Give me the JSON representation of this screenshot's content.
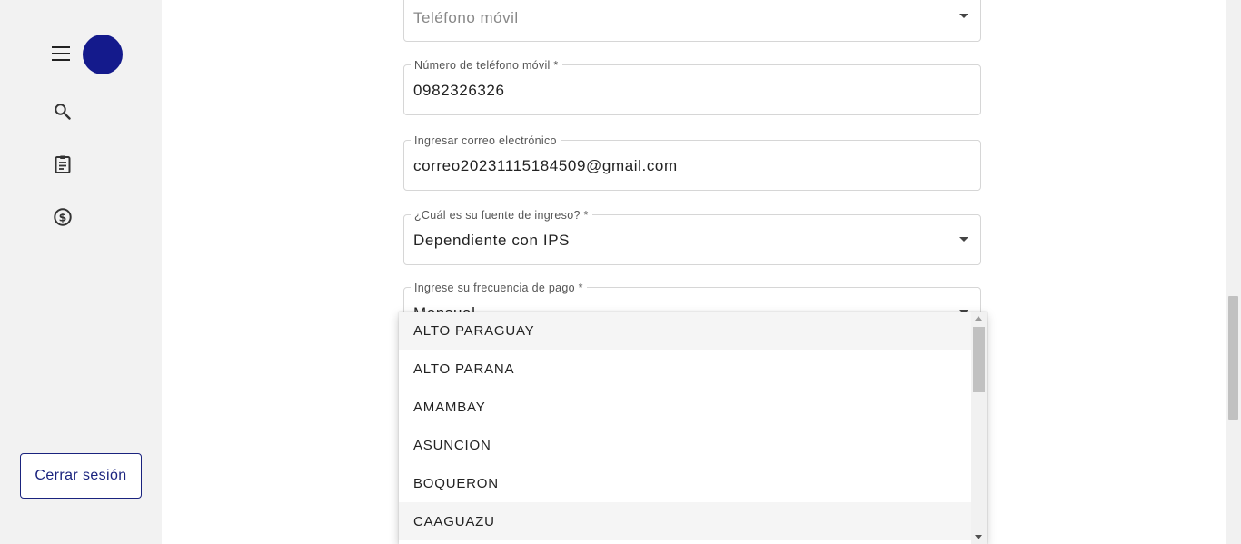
{
  "sidebar": {
    "icons": [
      "menu-icon",
      "search-icon",
      "clipboard-icon",
      "dollar-icon"
    ],
    "logout_label": "Cerrar sesión",
    "avatar_color": "#141a8c"
  },
  "form": {
    "phone_type": {
      "placeholder": "Teléfono móvil"
    },
    "mobile_number": {
      "label": "Número de teléfono móvil *",
      "value": "0982326326"
    },
    "email": {
      "label": "Ingresar correo electrónico",
      "value": "correo20231115184509@gmail.com"
    },
    "income_source": {
      "label": "¿Cuál es su fuente de ingreso? *",
      "value": "Dependiente con IPS"
    },
    "pay_frequency": {
      "label": "Ingrese su frecuencia de pago *",
      "value": "Mensual"
    }
  },
  "dropdown": {
    "options": [
      "ALTO PARAGUAY",
      "ALTO PARANA",
      "AMAMBAY",
      "ASUNCION",
      "BOQUERON",
      "CAAGUAZU"
    ]
  },
  "colors": {
    "accent": "#1a237e"
  }
}
